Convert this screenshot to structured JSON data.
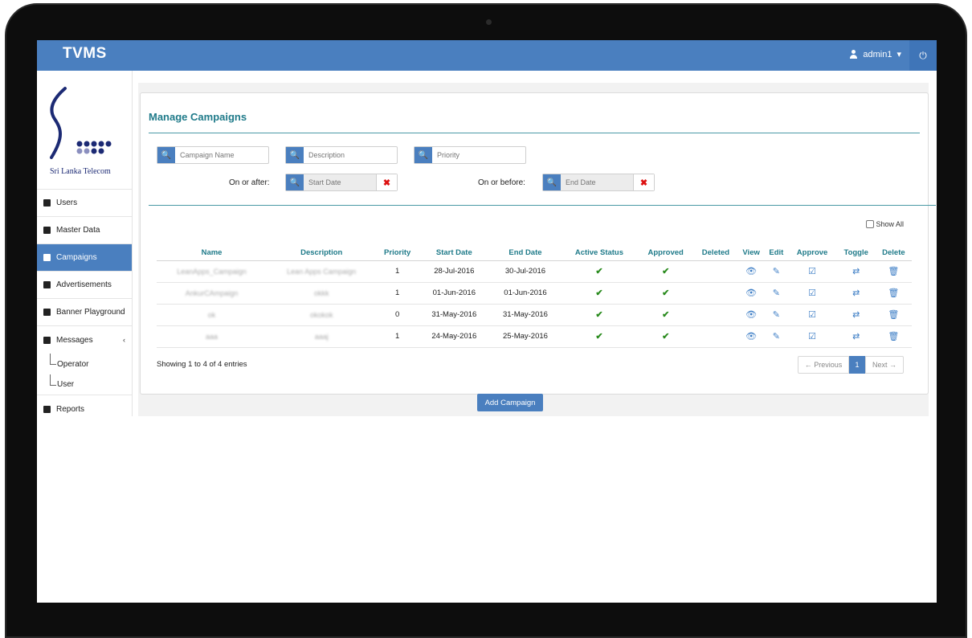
{
  "app": {
    "title": "TVMS"
  },
  "user_menu": {
    "username": "admin1",
    "caret": "▾",
    "power_icon": "⏻"
  },
  "sidebar": {
    "logo_text": "Sri Lanka Telecom",
    "items": [
      {
        "label": "Users",
        "icon": "user-icon"
      },
      {
        "label": "Master Data",
        "icon": "table-icon"
      },
      {
        "label": "Campaigns",
        "icon": "book-icon",
        "active": true
      },
      {
        "label": "Advertisements",
        "icon": "film-icon"
      },
      {
        "label": "Banner Playground",
        "icon": "wrench-icon"
      },
      {
        "label": "Messages",
        "icon": "envelope-icon",
        "chevron": "‹"
      }
    ],
    "sub_items": [
      {
        "label": "Operator"
      },
      {
        "label": "User"
      }
    ],
    "last_item": {
      "label": "Reports",
      "icon": "bar-chart-icon"
    }
  },
  "panel": {
    "title": "Manage Campaigns"
  },
  "filters": {
    "campaign_name_placeholder": "Campaign Name",
    "description_placeholder": "Description",
    "priority_placeholder": "Priority",
    "on_or_after_label": "On or after:",
    "on_or_before_label": "On or before:",
    "start_date_placeholder": "Start Date",
    "end_date_placeholder": "End Date",
    "clear_glyph": "✖",
    "search_glyph": "🔍"
  },
  "show_all_label": "Show All",
  "table": {
    "headers": {
      "name": "Name",
      "description": "Description",
      "priority": "Priority",
      "start_date": "Start Date",
      "end_date": "End Date",
      "active_status": "Active Status",
      "approved": "Approved",
      "deleted": "Deleted",
      "view": "View",
      "edit": "Edit",
      "approve": "Approve",
      "toggle": "Toggle",
      "delete": "Delete"
    },
    "rows": [
      {
        "name": "LeanApps_Campaign",
        "description": "Lean Apps Campaign",
        "priority": "1",
        "start_date": "28-Jul-2016",
        "end_date": "30-Jul-2016",
        "active": "✔",
        "approved": "✔",
        "deleted": ""
      },
      {
        "name": "AnkurCAmpaign",
        "description": "okkk",
        "priority": "1",
        "start_date": "01-Jun-2016",
        "end_date": "01-Jun-2016",
        "active": "✔",
        "approved": "✔",
        "deleted": ""
      },
      {
        "name": "ok",
        "description": "okokok",
        "priority": "0",
        "start_date": "31-May-2016",
        "end_date": "31-May-2016",
        "active": "✔",
        "approved": "✔",
        "deleted": ""
      },
      {
        "name": "aaa",
        "description": "aaaj",
        "priority": "1",
        "start_date": "24-May-2016",
        "end_date": "25-May-2016",
        "active": "✔",
        "approved": "✔",
        "deleted": ""
      }
    ],
    "action_glyphs": {
      "view": "👁",
      "edit": "✎",
      "approve": "☑",
      "toggle": "⇄",
      "delete": "🗑"
    }
  },
  "footer": {
    "entries_text": "Showing 1 to 4 of 4 entries",
    "prev_label": "← Previous",
    "current_page": "1",
    "next_label": "Next →"
  },
  "add_button_label": "Add Campaign",
  "colors": {
    "navbar": "#4a7fbf",
    "accent_teal": "#207b8a",
    "check_green": "#2a8b1e",
    "clear_red": "#dd1111"
  }
}
